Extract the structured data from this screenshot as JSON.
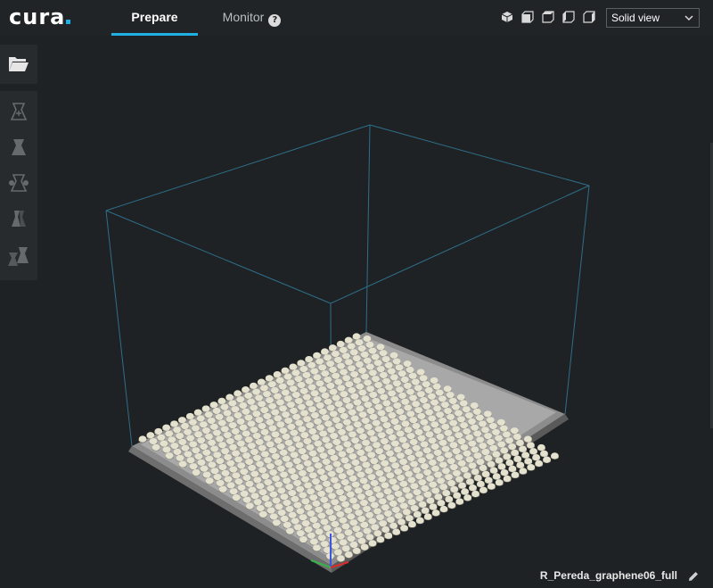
{
  "app": {
    "logo_text": "cura"
  },
  "tabs": [
    {
      "label": "Prepare",
      "active": true
    },
    {
      "label": "Monitor",
      "active": false
    }
  ],
  "view_buttons": [
    "3d-view-icon",
    "front-view-icon",
    "top-view-icon",
    "left-view-icon",
    "right-view-icon"
  ],
  "view_mode": {
    "selected": "Solid view"
  },
  "sidebar": {
    "open_icon": "open-folder-icon",
    "tools": [
      "move-tool-icon",
      "scale-tool-icon",
      "rotate-tool-icon",
      "mirror-tool-icon",
      "per-model-settings-icon"
    ]
  },
  "scene": {
    "object_filename": "R_Pereda_graphene06_full",
    "colors": {
      "background": "#1f2224",
      "build_volume_lines": "#2d6f8a",
      "plate": "#8c8c8c",
      "model": "#e4e1cf"
    },
    "grid_rows": 30,
    "grid_cols": 28
  }
}
